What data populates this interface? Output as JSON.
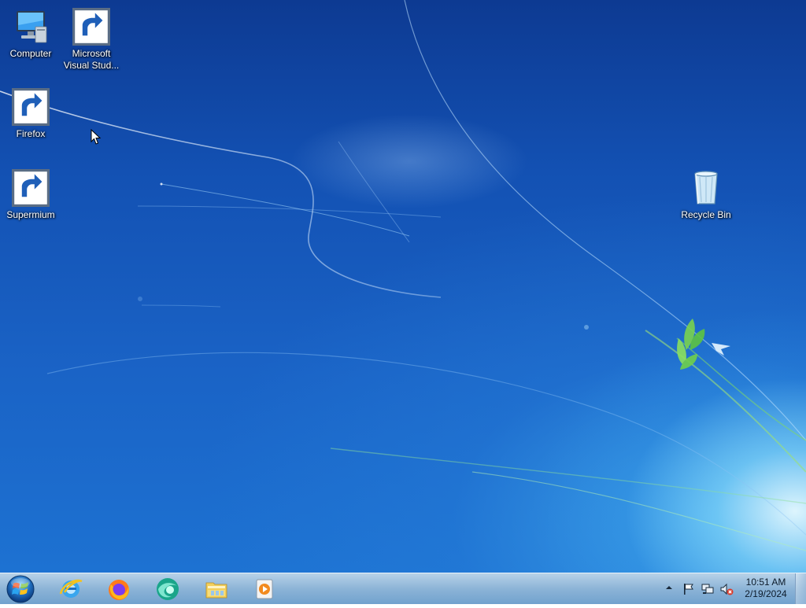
{
  "desktop": {
    "icons": [
      {
        "label": "Computer",
        "icon": "computer-icon"
      },
      {
        "label": "Microsoft\nVisual Stud...",
        "icon": "visual-studio-icon"
      },
      {
        "label": "Firefox",
        "icon": "firefox-icon"
      },
      {
        "label": "Supermium",
        "icon": "supermium-icon"
      },
      {
        "label": "Recycle Bin",
        "icon": "recycle-bin-icon"
      }
    ]
  },
  "taskbar": {
    "start_icon": "windows-start-orb-icon",
    "pinned": [
      {
        "icon": "internet-explorer-icon"
      },
      {
        "icon": "firefox-icon"
      },
      {
        "icon": "supermium-icon"
      },
      {
        "icon": "file-explorer-icon"
      },
      {
        "icon": "media-player-icon"
      }
    ],
    "tray": {
      "chevron_icon": "show-hidden-icons-chevron",
      "icons": [
        "action-center-flag-icon",
        "network-icon",
        "volume-muted-icon"
      ]
    },
    "clock": {
      "time": "10:51 AM",
      "date": "2/19/2024"
    }
  },
  "colors": {
    "desktop_bg": "#1351b3",
    "taskbar_bg": "#8fb3d6",
    "label_text": "#ffffff"
  }
}
